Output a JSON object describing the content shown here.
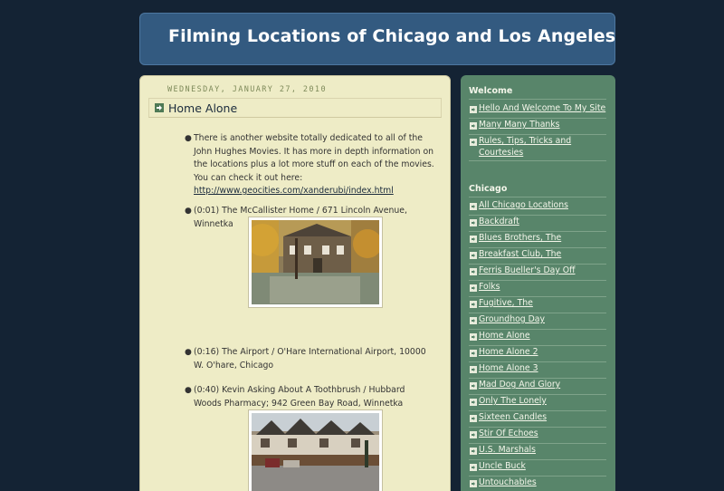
{
  "header": {
    "title": "Filming Locations of Chicago and Los Angeles"
  },
  "post": {
    "date": "Wednesday, January 27, 2010",
    "title": "Home Alone",
    "intro_text": "There is another website totally dedicated to all of the John Hughes Movies. It has more in depth information on the locations plus a lot more stuff on each of the movies. You can check it out here:",
    "intro_link": "http://www.geocities.com/xanderubi/index.html",
    "items": [
      {
        "text": "(0:01) The McCallister Home / 671 Lincoln Avenue, Winnetka",
        "photo": "house-photo"
      },
      {
        "text": "(0:16) The Airport / O'Hare International Airport, 10000 W. O'hare, Chicago"
      },
      {
        "text": "(0:40) Kevin Asking About A Toothbrush / Hubbard Woods Pharmacy; 942 Green Bay Road, Winnetka",
        "photo": "pharmacy-photo"
      }
    ]
  },
  "sidebar": {
    "welcome": {
      "heading": "Welcome",
      "items": [
        "Hello And Welcome To My Site",
        "Many Many Thanks",
        "Rules, Tips, Tricks and Courtesies"
      ]
    },
    "chicago": {
      "heading": "Chicago",
      "items": [
        "All Chicago Locations",
        "Backdraft",
        "Blues Brothers, The",
        "Breakfast Club, The",
        "Ferris Bueller's Day Off",
        "Folks",
        "Fugitive, The",
        "Groundhog Day",
        "Home Alone",
        "Home Alone 2",
        "Home Alone 3",
        "Mad Dog And Glory",
        "Only The Lonely",
        "Sixteen Candles",
        "Stir Of Echoes",
        "U.S. Marshals",
        "Uncle Buck",
        "Untouchables"
      ]
    }
  },
  "colors": {
    "background": "#142334",
    "header": "#335a80",
    "post_bg": "#eeecc6",
    "sidebar_bg": "#58856a"
  },
  "icons": {
    "post_title": "arrow-right-icon",
    "sidebar_bullet": "arrow-right-icon"
  }
}
